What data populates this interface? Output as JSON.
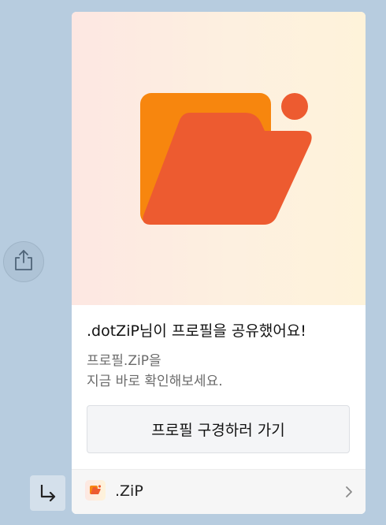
{
  "share": {
    "icon": "share-icon"
  },
  "reply": {
    "icon": "return-arrow-icon"
  },
  "card": {
    "hero_icon": "folder-icon",
    "title": ".dotZiP님이 프로필을 공유했어요!",
    "description": "프로필.ZiP을\n지금 바로 확인해보세요.",
    "cta_label": "프로필 구경하러 가기",
    "footer": {
      "icon": "app-folder-icon",
      "label": ".ZiP",
      "chevron": "chevron-right-icon"
    }
  },
  "colors": {
    "chat_background": "#b7ccdf",
    "folder_front": "#ed5b30",
    "folder_back": "#f7860e",
    "badge_dot": "#ed5b30"
  }
}
